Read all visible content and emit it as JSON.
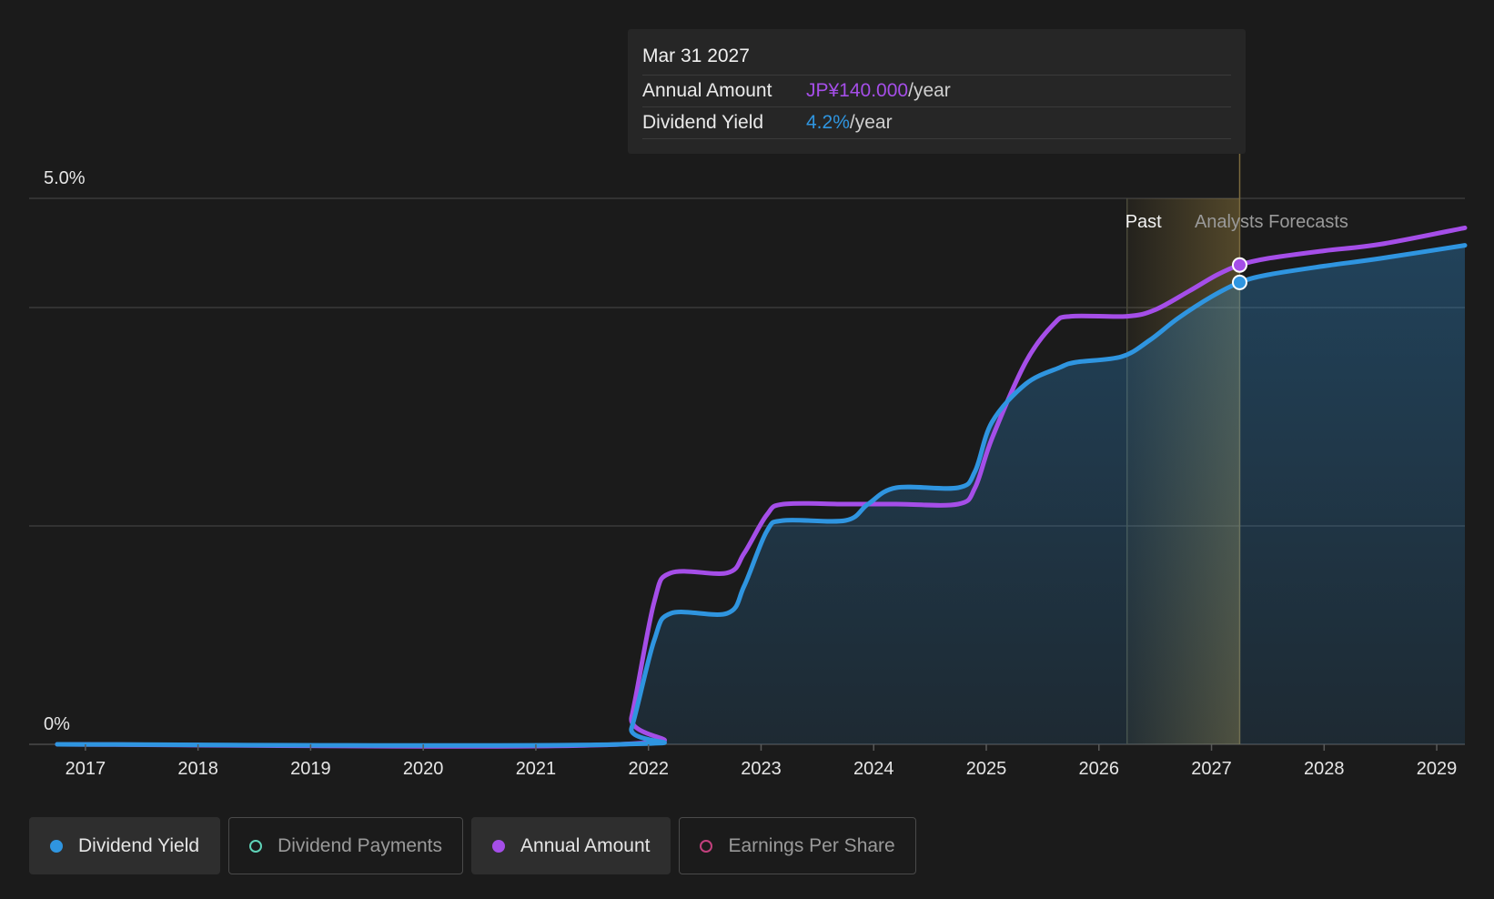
{
  "colors": {
    "yield": "#2f95e0",
    "annual": "#a54ee8",
    "payments": "#5fd3b8",
    "eps": "#c2407d",
    "forecast_band": "#5a4a2c",
    "grid": "#3a3a3a"
  },
  "tooltip": {
    "date": "Mar 31 2027",
    "rows": [
      {
        "label": "Annual Amount",
        "value": "JP¥140.000",
        "unit": "/year"
      },
      {
        "label": "Dividend Yield",
        "value": "4.2%",
        "unit": "/year"
      }
    ]
  },
  "legend": [
    {
      "label": "Dividend Yield",
      "active": true,
      "icon": "filled-dot-icon"
    },
    {
      "label": "Dividend Payments",
      "active": false,
      "icon": "hollow-dot-icon"
    },
    {
      "label": "Annual Amount",
      "active": true,
      "icon": "filled-dot-icon"
    },
    {
      "label": "Earnings Per Share",
      "active": false,
      "icon": "hollow-dot-icon"
    }
  ],
  "chart_data": {
    "type": "line",
    "y_tick_labels": [
      "5.0%",
      "0%"
    ],
    "ylim": [
      0,
      5
    ],
    "y_gridlines": [
      0,
      2,
      4,
      5
    ],
    "xlim": [
      2016.5,
      2029.25
    ],
    "x_ticks": [
      2017,
      2018,
      2019,
      2020,
      2021,
      2022,
      2023,
      2024,
      2025,
      2026,
      2027,
      2028,
      2029
    ],
    "region_labels": {
      "past": "Past",
      "forecast": "Analysts Forecasts"
    },
    "past_end_x": 2026.25,
    "highlight_x": 2027.25,
    "series": [
      {
        "name": "Dividend Yield",
        "key": "yield",
        "area": true,
        "points": [
          [
            2016.75,
            0
          ],
          [
            2021.75,
            0
          ],
          [
            2021.85,
            0.15
          ],
          [
            2022.05,
            0.95
          ],
          [
            2022.2,
            1.2
          ],
          [
            2022.7,
            1.2
          ],
          [
            2022.85,
            1.45
          ],
          [
            2023.05,
            1.95
          ],
          [
            2023.2,
            2.05
          ],
          [
            2023.75,
            2.05
          ],
          [
            2023.95,
            2.2
          ],
          [
            2024.2,
            2.35
          ],
          [
            2024.75,
            2.35
          ],
          [
            2024.9,
            2.5
          ],
          [
            2025.05,
            2.95
          ],
          [
            2025.35,
            3.3
          ],
          [
            2025.65,
            3.45
          ],
          [
            2025.8,
            3.5
          ],
          [
            2026.2,
            3.55
          ],
          [
            2026.45,
            3.7
          ],
          [
            2026.7,
            3.9
          ],
          [
            2027.0,
            4.1
          ],
          [
            2027.25,
            4.23
          ],
          [
            2027.5,
            4.3
          ],
          [
            2028.0,
            4.38
          ],
          [
            2028.5,
            4.45
          ],
          [
            2029.25,
            4.57
          ]
        ]
      },
      {
        "name": "Annual Amount",
        "key": "annual",
        "area": false,
        "points": [
          [
            2016.75,
            0
          ],
          [
            2021.75,
            0
          ],
          [
            2021.85,
            0.25
          ],
          [
            2022.05,
            1.3
          ],
          [
            2022.2,
            1.57
          ],
          [
            2022.7,
            1.57
          ],
          [
            2022.85,
            1.75
          ],
          [
            2023.05,
            2.1
          ],
          [
            2023.2,
            2.2
          ],
          [
            2023.75,
            2.2
          ],
          [
            2024.2,
            2.2
          ],
          [
            2024.75,
            2.2
          ],
          [
            2024.9,
            2.35
          ],
          [
            2025.05,
            2.8
          ],
          [
            2025.35,
            3.5
          ],
          [
            2025.6,
            3.85
          ],
          [
            2025.75,
            3.92
          ],
          [
            2026.25,
            3.92
          ],
          [
            2026.5,
            3.98
          ],
          [
            2026.8,
            4.15
          ],
          [
            2027.05,
            4.3
          ],
          [
            2027.25,
            4.39
          ],
          [
            2027.5,
            4.45
          ],
          [
            2028.0,
            4.52
          ],
          [
            2028.5,
            4.58
          ],
          [
            2029.25,
            4.73
          ]
        ]
      }
    ]
  }
}
